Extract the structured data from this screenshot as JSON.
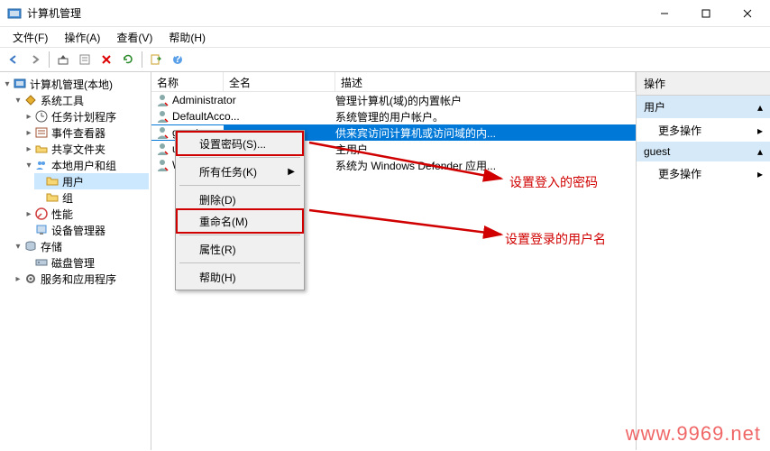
{
  "window": {
    "title": "计算机管理"
  },
  "menu": {
    "file": "文件(F)",
    "action": "操作(A)",
    "view": "查看(V)",
    "help": "帮助(H)"
  },
  "tree": {
    "root": "计算机管理(本地)",
    "system_tools": "系统工具",
    "task_scheduler": "任务计划程序",
    "event_viewer": "事件查看器",
    "shared_folders": "共享文件夹",
    "local_users_groups": "本地用户和组",
    "users": "用户",
    "groups": "组",
    "performance": "性能",
    "device_manager": "设备管理器",
    "storage": "存储",
    "disk_management": "磁盘管理",
    "services_apps": "服务和应用程序"
  },
  "list": {
    "col_name": "名称",
    "col_fullname": "全名",
    "col_desc": "描述",
    "rows": [
      {
        "name": "Administrator",
        "full": "",
        "desc": "管理计算机(域)的内置帐户"
      },
      {
        "name": "DefaultAcco...",
        "full": "",
        "desc": "系统管理的用户帐户。"
      },
      {
        "name": "guest",
        "full": "",
        "desc": "供来宾访问计算机或访问域的内..."
      },
      {
        "name": "user",
        "full": "",
        "desc": "主用户"
      },
      {
        "name": "WDAGUtility...",
        "full": "",
        "desc": "系统为 Windows Defender 应用..."
      }
    ]
  },
  "context_menu": {
    "set_password": "设置密码(S)...",
    "all_tasks": "所有任务(K)",
    "delete": "删除(D)",
    "rename": "重命名(M)",
    "properties": "属性(R)",
    "help": "帮助(H)"
  },
  "actions": {
    "header": "操作",
    "section_users": "用户",
    "more_actions": "更多操作",
    "section_guest": "guest"
  },
  "annotations": {
    "password": "设置登入的密码",
    "username": "设置登录的用户名"
  },
  "watermark": "www.9969.net"
}
